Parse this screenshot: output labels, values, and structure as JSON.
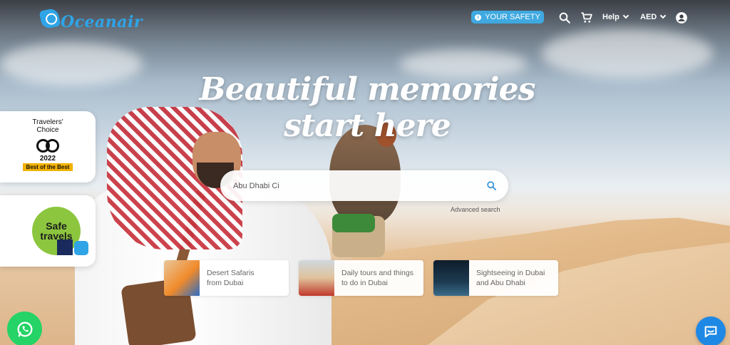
{
  "brand": {
    "name": "Oceanair"
  },
  "nav": {
    "safety_label": "YOUR SAFETY",
    "help_label": "Help",
    "currency_label": "AED"
  },
  "hero": {
    "headline": "Beautiful memories start here"
  },
  "search": {
    "value": "Abu Dhabi Ci",
    "advanced_label": "Advanced search"
  },
  "badges": {
    "travelers_choice": {
      "line1": "Travelers'",
      "line2": "Choice",
      "year": "2022",
      "tag": "Best of the Best"
    },
    "safe_travels": {
      "line1": "Safe",
      "line2": "travels"
    }
  },
  "categories": [
    {
      "line1": "Desert Safaris",
      "line2": "from Dubai"
    },
    {
      "line1": "Daily tours and things",
      "line2": "to do in Dubai"
    },
    {
      "line1": "Sightseeing in Dubai",
      "line2": "and Abu Dhabi"
    }
  ],
  "colors": {
    "accent": "#3fa9e0",
    "whatsapp": "#25d366",
    "chat": "#1e88e5",
    "badge_gold": "#f2b203",
    "safe_green": "#8cc63f"
  }
}
